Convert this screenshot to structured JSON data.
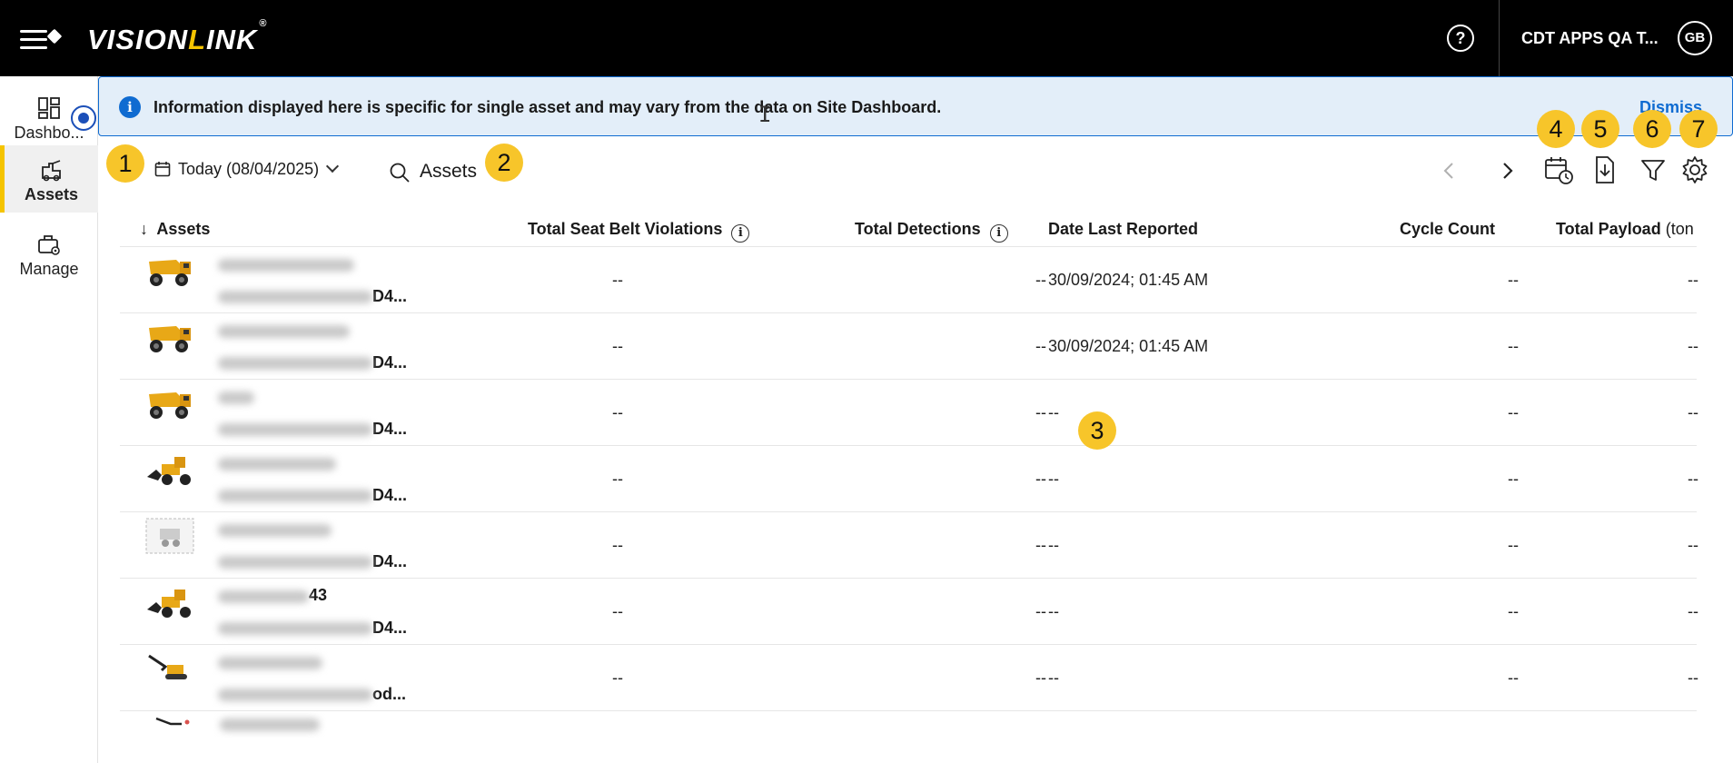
{
  "app": {
    "logo_prefix": "VISION",
    "logo_accent": "L",
    "logo_suffix": "INK",
    "logo_mark": "®",
    "org_name": "CDT APPS QA T...",
    "avatar_initials": "GB",
    "help_glyph": "?"
  },
  "sidebar": {
    "items": [
      {
        "label": "Dashbo...",
        "icon": "dashboard-icon",
        "active": false
      },
      {
        "label": "Assets",
        "icon": "assets-icon",
        "active": true
      },
      {
        "label": "Manage",
        "icon": "manage-icon",
        "active": false
      }
    ]
  },
  "banner": {
    "info_glyph": "i",
    "message": "Information displayed here is specific for single asset and may vary from the data on Site Dashboard.",
    "dismiss_label": "Dismiss"
  },
  "toolbar": {
    "date_label": "Today (08/04/2025)",
    "search_value": "Assets"
  },
  "callouts": [
    "1",
    "2",
    "3",
    "4",
    "5",
    "6",
    "7"
  ],
  "table": {
    "headers": {
      "assets": "Assets",
      "seat_belt": "Total Seat Belt Violations",
      "detections": "Total Detections",
      "date_last_reported": "Date Last Reported",
      "cycle_count": "Cycle Count",
      "payload": "Total Payload",
      "payload_unit": "(ton"
    },
    "rows": [
      {
        "thumb": "haul-truck",
        "sub_suffix": "D4...",
        "name_suffix": "",
        "seat_belt": "--",
        "detections": "--",
        "date": "30/09/2024; 01:45 AM",
        "cycles": "--",
        "payload": "--"
      },
      {
        "thumb": "haul-truck",
        "sub_suffix": "D4...",
        "name_suffix": "",
        "seat_belt": "--",
        "detections": "--",
        "date": "30/09/2024; 01:45 AM",
        "cycles": "--",
        "payload": "--"
      },
      {
        "thumb": "haul-truck",
        "sub_suffix": "D4...",
        "name_suffix": "",
        "seat_belt": "--",
        "detections": "--",
        "date": "--",
        "cycles": "--",
        "payload": "--"
      },
      {
        "thumb": "wheel-loader",
        "sub_suffix": "D4...",
        "name_suffix": "",
        "seat_belt": "--",
        "detections": "--",
        "date": "--",
        "cycles": "--",
        "payload": "--"
      },
      {
        "thumb": "placeholder",
        "sub_suffix": "D4...",
        "name_suffix": "",
        "seat_belt": "--",
        "detections": "--",
        "date": "--",
        "cycles": "--",
        "payload": "--"
      },
      {
        "thumb": "wheel-loader",
        "sub_suffix": "D4...",
        "name_suffix": "43",
        "seat_belt": "--",
        "detections": "--",
        "date": "--",
        "cycles": "--",
        "payload": "--"
      },
      {
        "thumb": "excavator",
        "sub_suffix": "od...",
        "name_suffix": "",
        "seat_belt": "--",
        "detections": "--",
        "date": "--",
        "cycles": "--",
        "payload": "--"
      }
    ]
  }
}
